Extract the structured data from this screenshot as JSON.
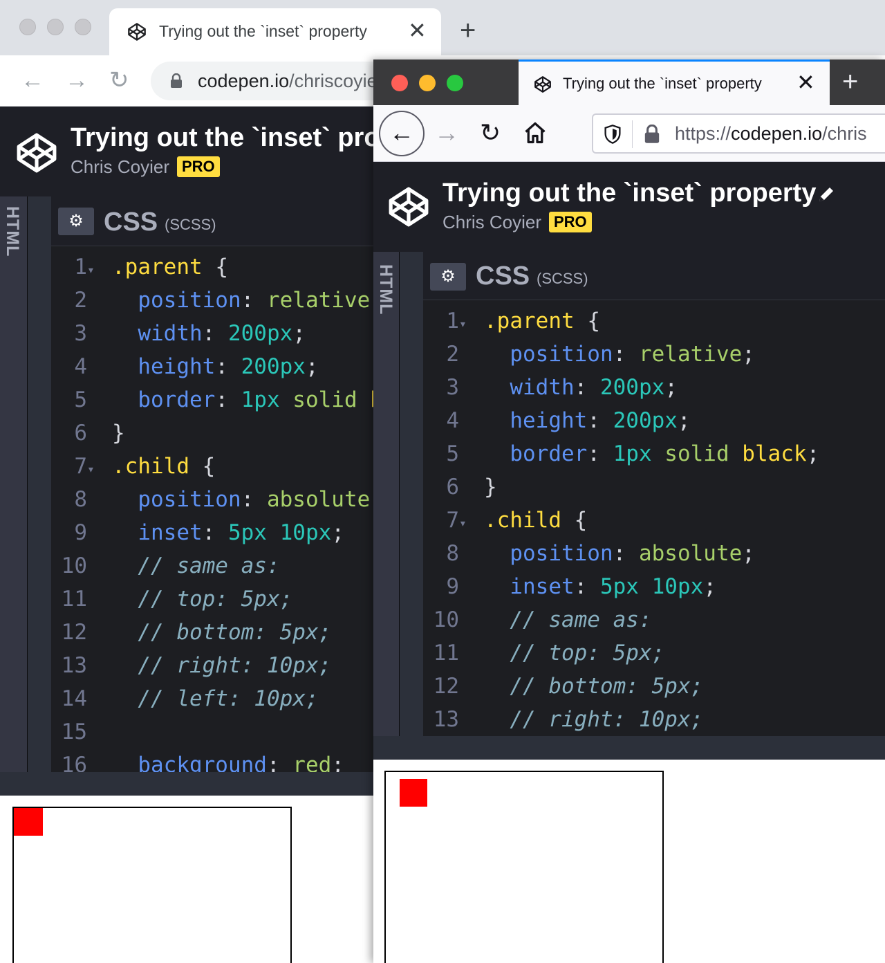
{
  "chrome": {
    "tab_title": "Trying out the `inset` property",
    "tab_close": "✕",
    "new_tab": "+",
    "url_host": "codepen.io",
    "url_path": "/chriscoyier/pen/",
    "nav": {
      "back": "←",
      "forward": "→",
      "reload": "↻"
    }
  },
  "firefox": {
    "tab_title": "Trying out the `inset` property",
    "tab_close": "✕",
    "new_tab": "+",
    "url_scheme": "https://",
    "url_host": "codepen.io",
    "url_path": "/chris",
    "nav": {
      "back": "←",
      "forward": "→",
      "reload": "↻"
    }
  },
  "codepen": {
    "pen_title": "Trying out the `inset` property",
    "author": "Chris Coyier",
    "badge": "PRO",
    "html_panel_label": "HTML",
    "editor_lang": "CSS",
    "editor_sublang": "(SCSS)",
    "settings_icon": "⚙",
    "fold_glyph": "▾"
  },
  "code_lines": [
    {
      "n": "1",
      "fold": true,
      "tokens": [
        {
          "t": ".parent",
          "c": "sel"
        },
        {
          "t": " {",
          "c": "brace"
        }
      ]
    },
    {
      "n": "2",
      "tokens": [
        {
          "t": "  position",
          "c": "prop"
        },
        {
          "t": ": ",
          "c": "punc"
        },
        {
          "t": "relative",
          "c": "kw"
        },
        {
          "t": ";",
          "c": "punc"
        }
      ]
    },
    {
      "n": "3",
      "tokens": [
        {
          "t": "  width",
          "c": "prop"
        },
        {
          "t": ": ",
          "c": "punc"
        },
        {
          "t": "200px",
          "c": "num"
        },
        {
          "t": ";",
          "c": "punc"
        }
      ]
    },
    {
      "n": "4",
      "tokens": [
        {
          "t": "  height",
          "c": "prop"
        },
        {
          "t": ": ",
          "c": "punc"
        },
        {
          "t": "200px",
          "c": "num"
        },
        {
          "t": ";",
          "c": "punc"
        }
      ]
    },
    {
      "n": "5",
      "tokens": [
        {
          "t": "  border",
          "c": "prop"
        },
        {
          "t": ": ",
          "c": "punc"
        },
        {
          "t": "1px",
          "c": "num"
        },
        {
          "t": " solid",
          "c": "kw"
        },
        {
          "t": " black",
          "c": "yel"
        },
        {
          "t": ";",
          "c": "punc"
        }
      ]
    },
    {
      "n": "6",
      "tokens": [
        {
          "t": "}",
          "c": "brace"
        }
      ]
    },
    {
      "n": "7",
      "fold": true,
      "tokens": [
        {
          "t": ".child",
          "c": "sel"
        },
        {
          "t": " {",
          "c": "brace"
        }
      ]
    },
    {
      "n": "8",
      "tokens": [
        {
          "t": "  position",
          "c": "prop"
        },
        {
          "t": ": ",
          "c": "punc"
        },
        {
          "t": "absolute",
          "c": "kw"
        },
        {
          "t": ";",
          "c": "punc"
        }
      ]
    },
    {
      "n": "9",
      "tokens": [
        {
          "t": "  inset",
          "c": "prop"
        },
        {
          "t": ": ",
          "c": "punc"
        },
        {
          "t": "5px",
          "c": "num"
        },
        {
          "t": " 10px",
          "c": "num"
        },
        {
          "t": ";",
          "c": "punc"
        }
      ]
    },
    {
      "n": "10",
      "tokens": [
        {
          "t": "  // same as:",
          "c": "cmt"
        }
      ]
    },
    {
      "n": "11",
      "tokens": [
        {
          "t": "  // top: 5px;",
          "c": "cmt"
        }
      ]
    },
    {
      "n": "12",
      "tokens": [
        {
          "t": "  // bottom: 5px;",
          "c": "cmt"
        }
      ]
    },
    {
      "n": "13",
      "tokens": [
        {
          "t": "  // right: 10px;",
          "c": "cmt"
        }
      ]
    },
    {
      "n": "14",
      "tokens": [
        {
          "t": "  // left: 10px;",
          "c": "cmt"
        }
      ]
    },
    {
      "n": "15",
      "tokens": []
    },
    {
      "n": "16",
      "tokens": [
        {
          "t": "  background",
          "c": "prop"
        },
        {
          "t": ": ",
          "c": "punc"
        },
        {
          "t": "red",
          "c": "kw"
        },
        {
          "t": ";",
          "c": "punc"
        }
      ]
    }
  ],
  "colors": {
    "codepen_bg": "#1e1f26",
    "pro_badge": "#ffdd40",
    "firefox_tab_accent": "#0a84ff",
    "child_box": "#ff0000"
  }
}
